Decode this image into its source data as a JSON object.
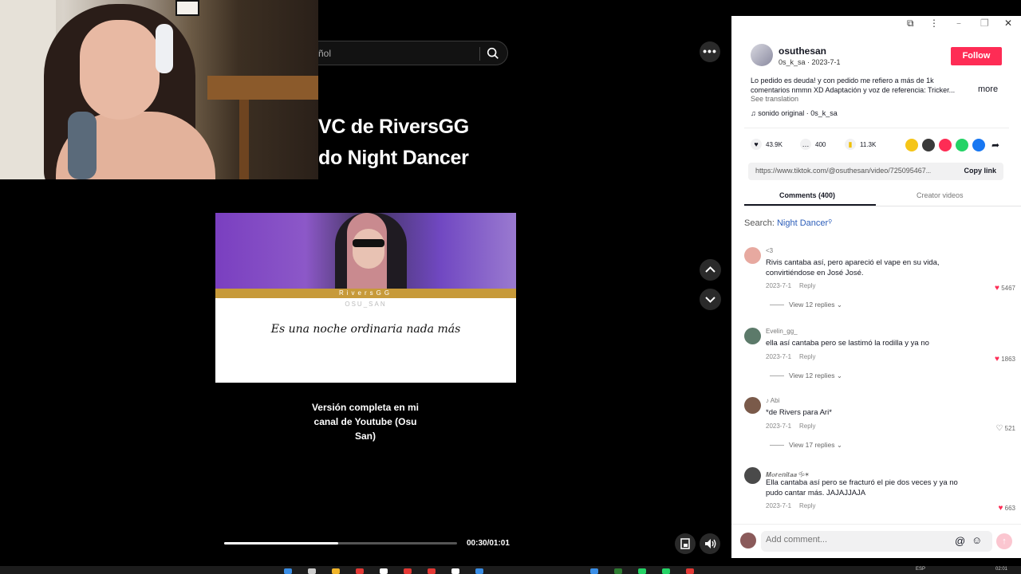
{
  "search": {
    "text": "ñol"
  },
  "video": {
    "title_line1": "VC de RiversGG",
    "title_line2": "do Night Dancer",
    "thumbnail": {
      "bar_text": "RiversGG",
      "sub_text": "OSU_SAN",
      "lyric": "Es una noche ordinaria nada más"
    },
    "caption": "Versión completa en mi canal de Youtube (Osu San)",
    "progress": 0.49,
    "time": "00:30/01:01"
  },
  "author": {
    "name": "osuthesan",
    "sub": "0s_k_sa · 2023-7-1",
    "follow_label": "Follow"
  },
  "description": "Lo pedido es deuda! y con pedido me refiero a más de 1k comentarios nmmn XD Adaptación y voz de referencia: Tricker...",
  "more_label": "more",
  "see_translation": "See translation",
  "sound": "♫  sonido original · 0s_k_sa",
  "stats": {
    "likes": "43.9K",
    "comments": "400",
    "saves": "11.3K"
  },
  "link": {
    "url": "https://www.tiktok.com/@osuthesan/video/725095467...",
    "copy_label": "Copy link"
  },
  "tabs": {
    "comments": "Comments (400)",
    "creator": "Creator videos"
  },
  "search_line": {
    "prefix": "Search: ",
    "keyword": "Night Dancer"
  },
  "comments": [
    {
      "user": "<3",
      "text": "Rivis cantaba así, pero apareció el vape en su vida, convirtiéndose en José José.",
      "date": "2023-7-1",
      "reply": "Reply",
      "likes": "5467",
      "liked": true,
      "views": "View 12 replies ⌄"
    },
    {
      "user": "Evelin_gg_",
      "text": "ella así cantaba pero se lastimó la rodilla y ya no",
      "date": "2023-7-1",
      "reply": "Reply",
      "likes": "1863",
      "liked": true,
      "views": "View 12 replies ⌄"
    },
    {
      "user": "♪ Abi",
      "text": "*de Rivers para Ari*",
      "date": "2023-7-1",
      "reply": "Reply",
      "likes": "521",
      "liked": false,
      "views": "View 17 replies ⌄"
    },
    {
      "user": "𝑴𝒐𝒓𝒆𝒏𝒊𝒕𝒂𝒂 🝰✶",
      "text": "Ella cantaba así pero se fracturó el pie dos veces y ya no pudo cantar más. JAJAJJAJA",
      "date": "2023-7-1",
      "reply": "Reply",
      "likes": "663",
      "liked": true,
      "views": ""
    }
  ],
  "comment_input": {
    "placeholder": "Add comment..."
  },
  "taskbar": {
    "lang": "ESP",
    "clock": "02:01"
  },
  "colors": {
    "accent": "#fe2c55",
    "link": "#2b5db9"
  }
}
